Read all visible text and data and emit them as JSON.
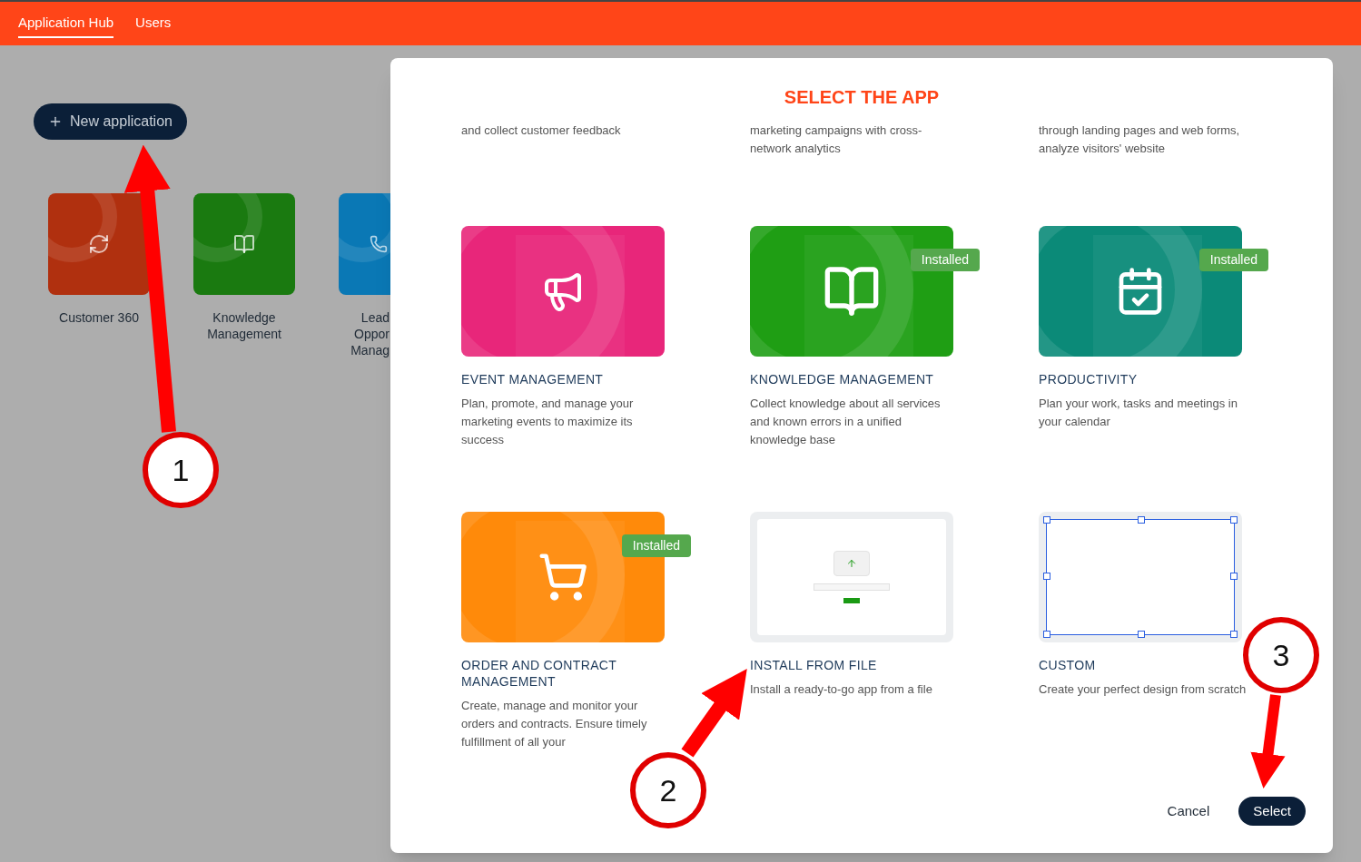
{
  "nav": [
    {
      "label": "Application Hub",
      "selected": true
    },
    {
      "label": "Users",
      "selected": false
    }
  ],
  "new_button": "New application",
  "apps": [
    {
      "name": [
        "Customer 360"
      ],
      "color": "#b0300f"
    },
    {
      "name": [
        "Knowledge",
        "Management"
      ],
      "color": "#1a7a10"
    },
    {
      "name": [
        "Lead",
        "Oppor",
        "Manag"
      ],
      "color": "#0a78b5"
    }
  ],
  "modal": {
    "title": "SELECT THE APP",
    "partial_row": [
      "and collect customer feedback",
      "marketing campaigns with cross-network analytics",
      "through landing pages and web forms, analyze visitors' website"
    ],
    "tiles": [
      {
        "kind": "app",
        "color": "#e8267a",
        "installed": false,
        "title": "EVENT MANAGEMENT",
        "description": "Plan, promote, and manage your marketing events to maximize its success"
      },
      {
        "kind": "app",
        "color": "#1f9e14",
        "installed": true,
        "badge": "Installed",
        "title": "KNOWLEDGE MANAGEMENT",
        "description": "Collect knowledge about all services and known errors in a unified knowledge base"
      },
      {
        "kind": "app",
        "color": "#0b8a78",
        "installed": true,
        "badge": "Installed",
        "title": "PRODUCTIVITY",
        "description": "Plan your work, tasks and meetings in your calendar"
      },
      {
        "kind": "app",
        "color": "#ff8a0a",
        "installed": true,
        "badge": "Installed",
        "title": "ORDER AND CONTRACT MANAGEMENT",
        "description": "Create, manage and monitor your orders and contracts. Ensure timely fulfillment of all your"
      },
      {
        "kind": "file",
        "installed": false,
        "title": "INSTALL FROM FILE",
        "description": "Install a ready-to-go app from a file"
      },
      {
        "kind": "custom",
        "installed": false,
        "title": "CUSTOM",
        "description": "Create your perfect design from scratch"
      }
    ],
    "cancel": "Cancel",
    "select": "Select"
  },
  "annotations": [
    "1",
    "2",
    "3"
  ]
}
